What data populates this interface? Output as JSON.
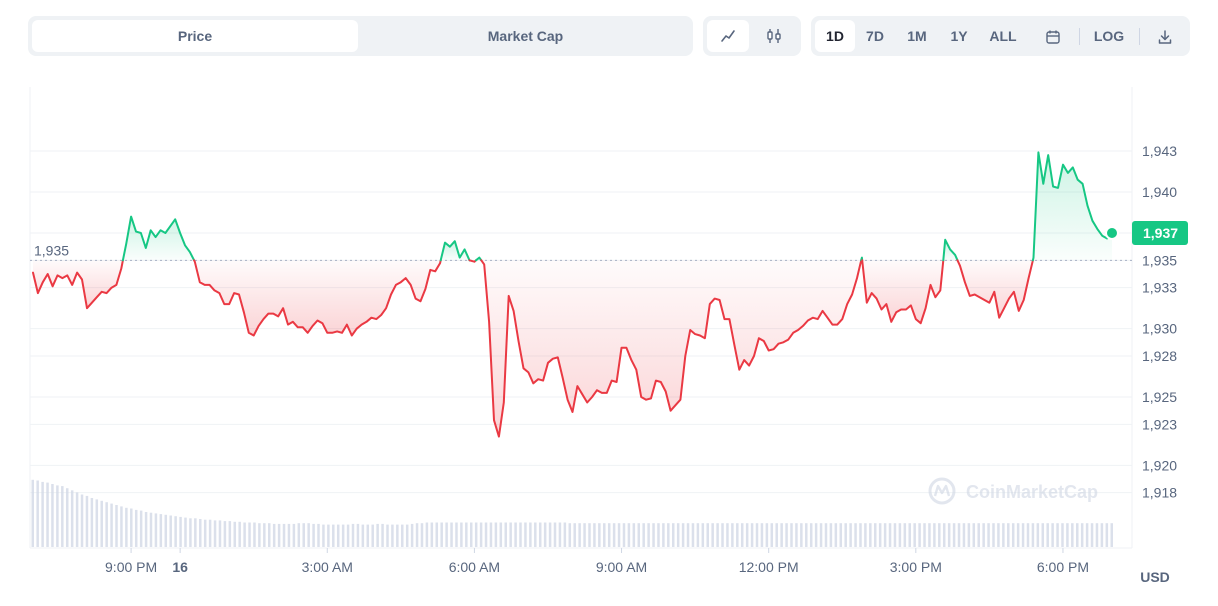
{
  "tabs": {
    "price": "Price",
    "market_cap": "Market Cap"
  },
  "chart_type_buttons": [
    {
      "icon": "line-chart-icon"
    },
    {
      "icon": "candlestick-icon"
    }
  ],
  "ranges": [
    "1D",
    "7D",
    "1M",
    "1Y",
    "ALL"
  ],
  "log_label": "LOG",
  "currency_label": "USD",
  "watermark": "CoinMarketCap",
  "colors": {
    "up": "#16c784",
    "down": "#ea3943",
    "volume": "#cfd6e4",
    "grid": "#eff2f5"
  },
  "chart_data": {
    "type": "line",
    "reference_value": 1935,
    "reference_label": "1,935",
    "current_value": 1937,
    "current_label": "1,937",
    "ylim": [
      1916,
      1946
    ],
    "y_ticks": [
      1918,
      1920,
      1923,
      1925,
      1928,
      1930,
      1933,
      1935,
      1937,
      1940,
      1943
    ],
    "y_tick_labels": [
      "1,918",
      "1,920",
      "1,923",
      "1,925",
      "1,928",
      "1,930",
      "1,933",
      "1,935",
      "1,937",
      "1,940",
      "1,943"
    ],
    "x_ticks": [
      {
        "t": 2,
        "label": "9:00 PM"
      },
      {
        "t": 3,
        "label": "16",
        "bold": true
      },
      {
        "t": 6,
        "label": "3:00 AM"
      },
      {
        "t": 9,
        "label": "6:00 AM"
      },
      {
        "t": 12,
        "label": "9:00 AM"
      },
      {
        "t": 15,
        "label": "12:00 PM"
      },
      {
        "t": 18,
        "label": "3:00 PM"
      },
      {
        "t": 21,
        "label": "6:00 PM"
      }
    ],
    "series": [
      {
        "values": [
          [
            0.0,
            1934.1
          ],
          [
            0.1,
            1932.6
          ],
          [
            0.2,
            1933.4
          ],
          [
            0.3,
            1934.0
          ],
          [
            0.4,
            1933.1
          ],
          [
            0.5,
            1933.9
          ],
          [
            0.6,
            1933.7
          ],
          [
            0.7,
            1933.9
          ],
          [
            0.8,
            1933.2
          ],
          [
            0.9,
            1934.1
          ],
          [
            1.0,
            1933.6
          ],
          [
            1.1,
            1931.5
          ],
          [
            1.2,
            1931.9
          ],
          [
            1.3,
            1932.3
          ],
          [
            1.4,
            1932.7
          ],
          [
            1.5,
            1932.6
          ],
          [
            1.6,
            1933.0
          ],
          [
            1.7,
            1933.2
          ],
          [
            1.8,
            1934.4
          ],
          [
            1.9,
            1936.2
          ],
          [
            2.0,
            1938.2
          ],
          [
            2.1,
            1937.1
          ],
          [
            2.2,
            1937.0
          ],
          [
            2.3,
            1935.9
          ],
          [
            2.4,
            1937.2
          ],
          [
            2.5,
            1936.7
          ],
          [
            2.6,
            1937.2
          ],
          [
            2.7,
            1937.0
          ],
          [
            2.8,
            1937.5
          ],
          [
            2.9,
            1938.0
          ],
          [
            3.0,
            1937.0
          ],
          [
            3.1,
            1936.1
          ],
          [
            3.2,
            1935.6
          ],
          [
            3.3,
            1934.9
          ],
          [
            3.4,
            1933.4
          ],
          [
            3.5,
            1933.2
          ],
          [
            3.6,
            1933.2
          ],
          [
            3.7,
            1932.8
          ],
          [
            3.8,
            1932.6
          ],
          [
            3.9,
            1931.8
          ],
          [
            4.0,
            1931.8
          ],
          [
            4.1,
            1932.6
          ],
          [
            4.2,
            1932.5
          ],
          [
            4.3,
            1931.2
          ],
          [
            4.4,
            1929.7
          ],
          [
            4.5,
            1929.5
          ],
          [
            4.6,
            1930.2
          ],
          [
            4.7,
            1930.7
          ],
          [
            4.8,
            1931.1
          ],
          [
            4.9,
            1931.1
          ],
          [
            5.0,
            1930.9
          ],
          [
            5.1,
            1931.5
          ],
          [
            5.2,
            1930.3
          ],
          [
            5.3,
            1930.5
          ],
          [
            5.4,
            1930.1
          ],
          [
            5.5,
            1930.1
          ],
          [
            5.6,
            1929.7
          ],
          [
            5.7,
            1930.2
          ],
          [
            5.8,
            1930.6
          ],
          [
            5.9,
            1930.4
          ],
          [
            6.0,
            1929.7
          ],
          [
            6.1,
            1929.7
          ],
          [
            6.2,
            1929.8
          ],
          [
            6.3,
            1929.7
          ],
          [
            6.4,
            1930.3
          ],
          [
            6.5,
            1929.5
          ],
          [
            6.6,
            1930.0
          ],
          [
            6.7,
            1930.3
          ],
          [
            6.8,
            1930.5
          ],
          [
            6.9,
            1930.8
          ],
          [
            7.0,
            1930.7
          ],
          [
            7.1,
            1931.0
          ],
          [
            7.2,
            1931.5
          ],
          [
            7.3,
            1932.5
          ],
          [
            7.4,
            1933.2
          ],
          [
            7.5,
            1933.4
          ],
          [
            7.6,
            1933.7
          ],
          [
            7.7,
            1933.2
          ],
          [
            7.8,
            1932.2
          ],
          [
            7.9,
            1932.0
          ],
          [
            8.0,
            1932.9
          ],
          [
            8.1,
            1934.3
          ],
          [
            8.2,
            1934.2
          ],
          [
            8.3,
            1934.8
          ],
          [
            8.4,
            1936.3
          ],
          [
            8.5,
            1936.0
          ],
          [
            8.6,
            1936.4
          ],
          [
            8.7,
            1935.2
          ],
          [
            8.8,
            1935.8
          ],
          [
            8.9,
            1935.0
          ],
          [
            9.0,
            1934.9
          ],
          [
            9.1,
            1935.2
          ],
          [
            9.2,
            1934.7
          ],
          [
            9.3,
            1930.5
          ],
          [
            9.4,
            1923.3
          ],
          [
            9.5,
            1922.1
          ],
          [
            9.6,
            1924.6
          ],
          [
            9.7,
            1932.4
          ],
          [
            9.8,
            1931.3
          ],
          [
            9.9,
            1929.1
          ],
          [
            10.0,
            1927.1
          ],
          [
            10.1,
            1926.8
          ],
          [
            10.2,
            1926.0
          ],
          [
            10.3,
            1926.3
          ],
          [
            10.4,
            1926.2
          ],
          [
            10.5,
            1927.5
          ],
          [
            10.6,
            1927.8
          ],
          [
            10.7,
            1927.9
          ],
          [
            10.8,
            1926.4
          ],
          [
            10.9,
            1924.8
          ],
          [
            11.0,
            1923.9
          ],
          [
            11.1,
            1925.8
          ],
          [
            11.2,
            1925.2
          ],
          [
            11.3,
            1924.6
          ],
          [
            11.4,
            1925.0
          ],
          [
            11.5,
            1925.5
          ],
          [
            11.6,
            1925.3
          ],
          [
            11.7,
            1925.3
          ],
          [
            11.8,
            1926.2
          ],
          [
            11.9,
            1926.1
          ],
          [
            12.0,
            1928.6
          ],
          [
            12.1,
            1928.6
          ],
          [
            12.2,
            1927.7
          ],
          [
            12.3,
            1927.0
          ],
          [
            12.4,
            1925.0
          ],
          [
            12.5,
            1924.8
          ],
          [
            12.6,
            1924.9
          ],
          [
            12.7,
            1926.2
          ],
          [
            12.8,
            1926.1
          ],
          [
            12.9,
            1925.4
          ],
          [
            13.0,
            1924.0
          ],
          [
            13.1,
            1924.4
          ],
          [
            13.2,
            1924.8
          ],
          [
            13.3,
            1928.0
          ],
          [
            13.4,
            1929.9
          ],
          [
            13.5,
            1929.6
          ],
          [
            13.6,
            1929.5
          ],
          [
            13.7,
            1929.3
          ],
          [
            13.8,
            1931.8
          ],
          [
            13.9,
            1932.2
          ],
          [
            14.0,
            1932.1
          ],
          [
            14.1,
            1930.7
          ],
          [
            14.2,
            1930.7
          ],
          [
            14.3,
            1928.8
          ],
          [
            14.4,
            1927.0
          ],
          [
            14.5,
            1927.7
          ],
          [
            14.6,
            1927.3
          ],
          [
            14.7,
            1928.0
          ],
          [
            14.8,
            1929.3
          ],
          [
            14.9,
            1929.1
          ],
          [
            15.0,
            1928.4
          ],
          [
            15.1,
            1928.5
          ],
          [
            15.2,
            1928.9
          ],
          [
            15.3,
            1929.0
          ],
          [
            15.4,
            1929.2
          ],
          [
            15.5,
            1929.7
          ],
          [
            15.6,
            1929.9
          ],
          [
            15.7,
            1930.2
          ],
          [
            15.8,
            1930.6
          ],
          [
            15.9,
            1930.8
          ],
          [
            16.0,
            1930.7
          ],
          [
            16.1,
            1931.3
          ],
          [
            16.2,
            1930.8
          ],
          [
            16.3,
            1930.3
          ],
          [
            16.4,
            1930.3
          ],
          [
            16.5,
            1930.7
          ],
          [
            16.6,
            1931.8
          ],
          [
            16.7,
            1932.5
          ],
          [
            16.8,
            1933.7
          ],
          [
            16.9,
            1935.2
          ],
          [
            17.0,
            1931.9
          ],
          [
            17.1,
            1932.6
          ],
          [
            17.2,
            1932.2
          ],
          [
            17.3,
            1931.4
          ],
          [
            17.4,
            1931.8
          ],
          [
            17.5,
            1930.5
          ],
          [
            17.6,
            1931.2
          ],
          [
            17.7,
            1931.4
          ],
          [
            17.8,
            1931.4
          ],
          [
            17.9,
            1931.7
          ],
          [
            18.0,
            1930.7
          ],
          [
            18.1,
            1930.4
          ],
          [
            18.2,
            1931.5
          ],
          [
            18.3,
            1933.2
          ],
          [
            18.4,
            1932.3
          ],
          [
            18.5,
            1932.8
          ],
          [
            18.6,
            1936.5
          ],
          [
            18.7,
            1935.8
          ],
          [
            18.8,
            1935.4
          ],
          [
            18.9,
            1934.6
          ],
          [
            19.0,
            1933.4
          ],
          [
            19.1,
            1932.4
          ],
          [
            19.2,
            1932.5
          ],
          [
            19.3,
            1932.3
          ],
          [
            19.4,
            1932.1
          ],
          [
            19.5,
            1931.9
          ],
          [
            19.6,
            1932.7
          ],
          [
            19.7,
            1930.8
          ],
          [
            19.8,
            1931.5
          ],
          [
            19.9,
            1932.2
          ],
          [
            20.0,
            1932.7
          ],
          [
            20.1,
            1931.3
          ],
          [
            20.2,
            1932.1
          ],
          [
            20.3,
            1933.7
          ],
          [
            20.4,
            1935.2
          ],
          [
            20.5,
            1942.9
          ],
          [
            20.6,
            1940.6
          ],
          [
            20.7,
            1942.7
          ],
          [
            20.8,
            1940.4
          ],
          [
            20.9,
            1940.3
          ],
          [
            21.0,
            1942.0
          ],
          [
            21.1,
            1941.4
          ],
          [
            21.2,
            1941.8
          ],
          [
            21.3,
            1940.9
          ],
          [
            21.4,
            1940.6
          ],
          [
            21.5,
            1939.0
          ],
          [
            21.6,
            1937.9
          ],
          [
            21.7,
            1937.3
          ],
          [
            21.8,
            1936.8
          ],
          [
            21.9,
            1936.6
          ],
          [
            22.0,
            1937.0
          ]
        ]
      }
    ],
    "volume": [
      9.6,
      9.5,
      9.3,
      9.2,
      9.0,
      8.8,
      8.7,
      8.4,
      8.1,
      7.8,
      7.5,
      7.3,
      7.0,
      6.8,
      6.6,
      6.4,
      6.2,
      6.0,
      5.8,
      5.6,
      5.5,
      5.3,
      5.2,
      5.0,
      4.9,
      4.8,
      4.7,
      4.6,
      4.5,
      4.4,
      4.3,
      4.2,
      4.1,
      4.1,
      4.0,
      3.9,
      3.9,
      3.8,
      3.8,
      3.7,
      3.7,
      3.6,
      3.6,
      3.5,
      3.5,
      3.5,
      3.4,
      3.4,
      3.4,
      3.3,
      3.3,
      3.3,
      3.3,
      3.3,
      3.4,
      3.4,
      3.4,
      3.3,
      3.3,
      3.2,
      3.2,
      3.2,
      3.2,
      3.2,
      3.2,
      3.3,
      3.3,
      3.2,
      3.2,
      3.2,
      3.3,
      3.3,
      3.2,
      3.2,
      3.2,
      3.2,
      3.2,
      3.3,
      3.4,
      3.4,
      3.5,
      3.5,
      3.5,
      3.5,
      3.5,
      3.5,
      3.5,
      3.5,
      3.5,
      3.5,
      3.5,
      3.5,
      3.5,
      3.5,
      3.5,
      3.5,
      3.5,
      3.5,
      3.5,
      3.5,
      3.5,
      3.5,
      3.5,
      3.5,
      3.5,
      3.5,
      3.5,
      3.5,
      3.5,
      3.4,
      3.4,
      3.4,
      3.4,
      3.4,
      3.4,
      3.4,
      3.4,
      3.4,
      3.4,
      3.4,
      3.4,
      3.4,
      3.4,
      3.4,
      3.4,
      3.4,
      3.4,
      3.4,
      3.4,
      3.4,
      3.4,
      3.4,
      3.4,
      3.4,
      3.4,
      3.4,
      3.4,
      3.4,
      3.4,
      3.4,
      3.4,
      3.4,
      3.4,
      3.4,
      3.4,
      3.4,
      3.4,
      3.4,
      3.4,
      3.4,
      3.4,
      3.4,
      3.4,
      3.4,
      3.4,
      3.4,
      3.4,
      3.4,
      3.4,
      3.4,
      3.4,
      3.4,
      3.4,
      3.4,
      3.4,
      3.4,
      3.4,
      3.4,
      3.4,
      3.4,
      3.4,
      3.4,
      3.4,
      3.4,
      3.4,
      3.4,
      3.4,
      3.4,
      3.4,
      3.4,
      3.4,
      3.4,
      3.4,
      3.4,
      3.4,
      3.4,
      3.4,
      3.4,
      3.4,
      3.4,
      3.4,
      3.4,
      3.4,
      3.4,
      3.4,
      3.4,
      3.4,
      3.4,
      3.4,
      3.4,
      3.4,
      3.4,
      3.4,
      3.4,
      3.4,
      3.4,
      3.4,
      3.4,
      3.4,
      3.4,
      3.4,
      3.4,
      3.4,
      3.4,
      3.4,
      3.4,
      3.4,
      3.4,
      3.4,
      3.4
    ]
  }
}
